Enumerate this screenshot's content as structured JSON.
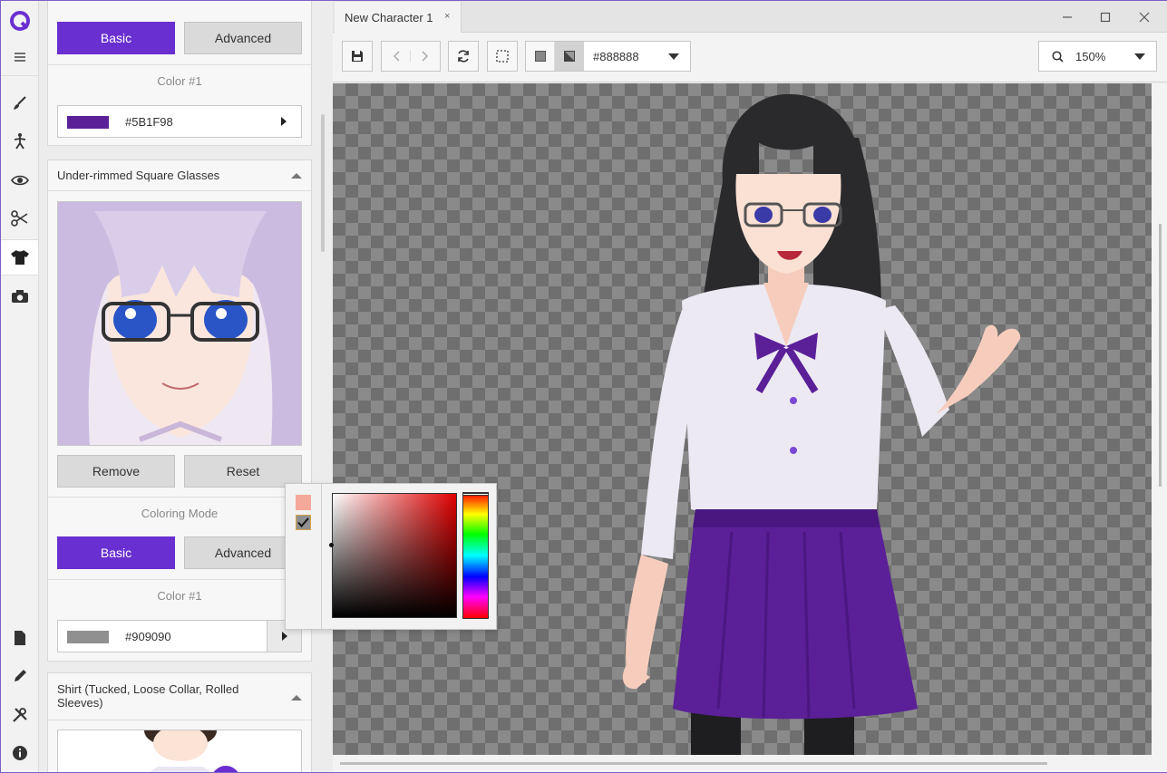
{
  "app": {
    "icons": [
      "app-logo-icon",
      "menu-icon",
      "brush-icon",
      "pose-icon",
      "eye-icon",
      "scissors-icon",
      "shirt-icon",
      "camera-icon",
      "document-icon",
      "pencil-icon",
      "tools-icon",
      "info-icon"
    ]
  },
  "panel": {
    "section1": {
      "basic_label": "Basic",
      "advanced_label": "Advanced",
      "color_label": "Color #1",
      "color_hex": "#5B1F98",
      "color_swatch": "#5B1F98"
    },
    "glasses": {
      "title": "Under-rimmed Square Glasses",
      "remove_label": "Remove",
      "reset_label": "Reset",
      "coloring_mode_label": "Coloring Mode",
      "basic_label": "Basic",
      "advanced_label": "Advanced",
      "color_label": "Color #1",
      "color_hex": "#909090",
      "color_swatch": "#909090"
    },
    "shirt": {
      "title": "Shirt (Tucked, Loose Collar, Rolled Sleeves)"
    }
  },
  "tabs": [
    {
      "label": "New Character 1",
      "close": "×"
    }
  ],
  "window": {
    "minimize": "—",
    "maximize": "☐",
    "close": "✕"
  },
  "toolbar": {
    "background_hex": "#888888",
    "zoom": "150%"
  },
  "picker": {
    "swatch_recent": "#f4a899",
    "swatch_current": "#909090"
  },
  "colors": {
    "accent": "#6a2fd0",
    "skirt": "#5b1f98"
  }
}
